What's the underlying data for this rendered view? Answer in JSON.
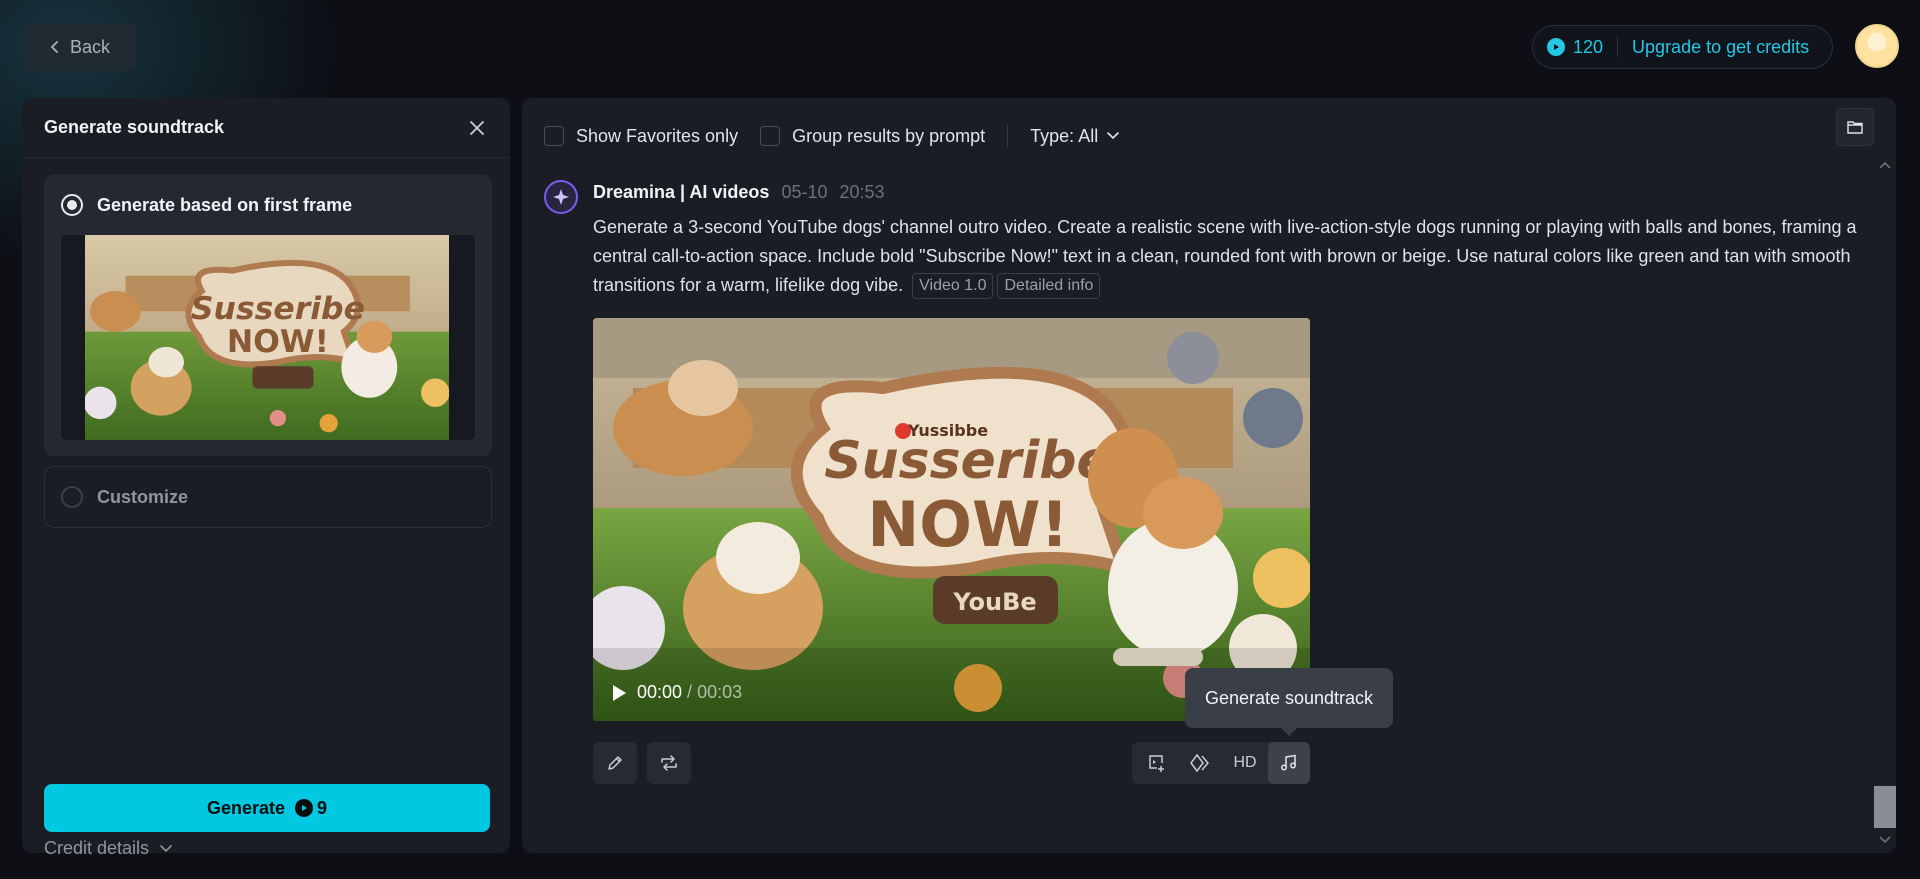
{
  "topbar": {
    "back_label": "Back",
    "credits": "120",
    "upgrade_label": "Upgrade to get credits"
  },
  "left_panel": {
    "title": "Generate soundtrack",
    "option_first_frame": "Generate based on first frame",
    "option_customize": "Customize",
    "credit_details": "Credit details",
    "generate_label": "Generate",
    "generate_cost": "9"
  },
  "toolbar": {
    "favorites_label": "Show Favorites only",
    "group_label": "Group results by prompt",
    "type_label": "Type: All"
  },
  "post": {
    "author": "Dreamina | AI videos",
    "date": "05-10",
    "time": "20:53",
    "prompt": "Generate a 3-second YouTube dogs' channel outro video. Create a realistic scene with live-action-style dogs running or playing with balls and bones, framing a central call-to-action space. Include bold \"Subscribe Now!\" text in a clean, rounded font with brown or beige. Use natural colors like green and tan with smooth transitions for a warm, lifelike dog vibe.",
    "tag_model": "Video 1.0",
    "tag_info": "Detailed info"
  },
  "video": {
    "sign_line1": "Susseribe",
    "sign_line2": "NOW!",
    "sign_small": "Yussibbe",
    "sign_tab": "YouBe",
    "time_current": "00:00",
    "time_separator": " / ",
    "time_total": "00:03"
  },
  "actions": {
    "hd_label": "HD",
    "tooltip": "Generate soundtrack"
  },
  "colors": {
    "accent": "#00c8e0",
    "panel": "#1a1d24",
    "background": "#0d0f14"
  }
}
